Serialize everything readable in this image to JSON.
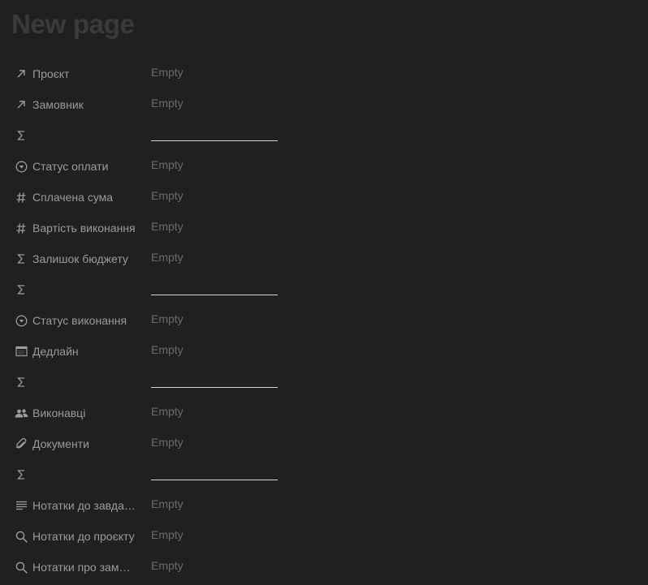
{
  "page": {
    "title": "New page"
  },
  "properties": [
    {
      "icon": "relation-arrow-icon",
      "label": "Проєкт",
      "value": "Empty"
    },
    {
      "icon": "relation-arrow-icon",
      "label": "Замовник",
      "value": "Empty"
    },
    {
      "icon": "sigma-icon",
      "label": "",
      "value": ""
    },
    {
      "icon": "status-icon",
      "label": "Статус оплати",
      "value": "Empty"
    },
    {
      "icon": "hash-icon",
      "label": "Сплачена сума",
      "value": "Empty"
    },
    {
      "icon": "hash-icon",
      "label": "Вартість виконання",
      "value": "Empty"
    },
    {
      "icon": "sigma-icon",
      "label": "Залишок бюджету",
      "value": "Empty"
    },
    {
      "icon": "sigma-icon",
      "label": "",
      "value": ""
    },
    {
      "icon": "status-icon",
      "label": "Статус виконання",
      "value": "Empty"
    },
    {
      "icon": "calendar-icon",
      "label": "Дедлайн",
      "value": "Empty"
    },
    {
      "icon": "sigma-icon",
      "label": "",
      "value": ""
    },
    {
      "icon": "people-icon",
      "label": "Виконавці",
      "value": "Empty"
    },
    {
      "icon": "paperclip-icon",
      "label": "Документи",
      "value": "Empty"
    },
    {
      "icon": "sigma-icon",
      "label": "",
      "value": ""
    },
    {
      "icon": "text-lines-icon",
      "label": "Нотатки до завдання",
      "value": "Empty"
    },
    {
      "icon": "search-icon",
      "label": "Нотатки до проєкту",
      "value": "Empty"
    },
    {
      "icon": "search-icon",
      "label": "Нотатки про замовника",
      "value": "Empty"
    }
  ]
}
